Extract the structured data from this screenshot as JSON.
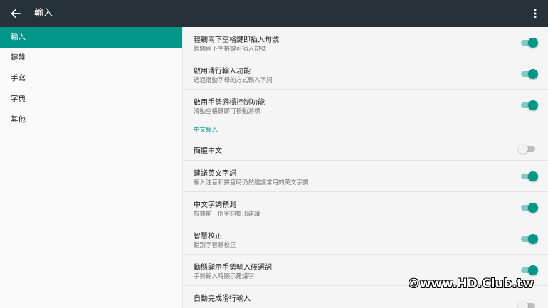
{
  "appbar": {
    "title": "輸入"
  },
  "sidebar": {
    "items": [
      {
        "label": "輸入",
        "active": true
      },
      {
        "label": "鍵盤"
      },
      {
        "label": "手寫"
      },
      {
        "label": "字典"
      },
      {
        "label": "其他"
      }
    ]
  },
  "settings": {
    "double_space": {
      "title": "輕觸兩下空格鍵即插入句號",
      "summary": "輕觸兩下空格鍵可插入句號",
      "on": true
    },
    "gesture_typing": {
      "title": "啟用滑行輸入功能",
      "summary": "透過滑動字母的方式輸入字詞",
      "on": true
    },
    "gesture_cursor": {
      "title": "啟用手勢游標控制功能",
      "summary": "滑動空格鍵即可移動游標",
      "on": true
    },
    "section_chinese": "中文輸入",
    "simplified": {
      "title": "簡體中文",
      "on": false
    },
    "suggest_english": {
      "title": "建議英文字詞",
      "summary": "輸入注音和拼音時仍然建議常用的英文字詞",
      "on": true
    },
    "prediction": {
      "title": "中文字詞預測",
      "summary": "根據前一個字詞提出建議",
      "on": true
    },
    "autocorrect": {
      "title": "智慧校正",
      "summary": "錯別字智慧校正",
      "on": true
    },
    "dynamic_float": {
      "title": "動態顯示手勢輸入候選詞",
      "summary": "手勢輸入時顯示建議字",
      "on": true
    },
    "auto_complete": {
      "title": "自動完成滑行輸入",
      "on": false
    }
  },
  "watermark": "©www.HD.Club.tw",
  "colors": {
    "appbar": "#263238",
    "accent": "#009688"
  }
}
